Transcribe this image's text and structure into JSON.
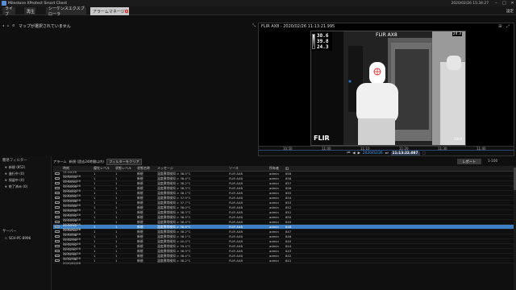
{
  "app": {
    "title": "Milestone XProtect Smart Client",
    "clock": "2020/02/26 15:34:27"
  },
  "tabs": [
    {
      "label": "ライブ"
    },
    {
      "label": "再生"
    },
    {
      "label": "シーケンスエクスプローラ"
    },
    {
      "label": "アラームマネージャ"
    }
  ],
  "setup_label": "設定",
  "map": {
    "message": "マップが選択されていません"
  },
  "video": {
    "header": "FLIR AX8 - 2020/02/26 11:13:21.995",
    "camera_label": "FLIR AX8",
    "fps": "24.3",
    "scale_values": [
      "38.6",
      "39.8",
      "24.3"
    ],
    "logo_text": "FLIR",
    "spot_value": "19.9",
    "timeline_ticks": [
      "10:50",
      "11:00",
      "11:10",
      "11:20",
      "11:30",
      "11:40"
    ],
    "date": "2020/02/26",
    "current_time": "11:13:22.087"
  },
  "left_panel": {
    "filter_heading": "簡易フィルター",
    "filters": [
      {
        "label": "新規 (852)"
      },
      {
        "label": "進行中 (0)"
      },
      {
        "label": "保留中 (0)"
      },
      {
        "label": "終了済み (0)"
      }
    ],
    "server_heading": "サーバー",
    "server": "SCH-PC-8996"
  },
  "alarm_toolbar": {
    "label": "アラーム",
    "filter_text": "新規 (過去24時間以内)",
    "clear_filter": "フィルターをクリア",
    "report": "レポート",
    "page_info": "1-100"
  },
  "table": {
    "headers": [
      "",
      "時刻",
      "優先レベル",
      "状態レベル",
      "状態名称",
      "メッセージ",
      "ソース",
      "所有者",
      "ID"
    ],
    "rows": [
      [
        "11:14:25 2020/02/26",
        "1",
        "1",
        "新規",
        "温度異常検知 > 38.5°C",
        "FLIR AX8",
        "admin",
        "858"
      ],
      [
        "11:14:20 2020/02/26",
        "1",
        "1",
        "新規",
        "温度異常検知 > 38.4°C",
        "FLIR AX8",
        "admin",
        "858"
      ],
      [
        "11:14:14 2020/02/26",
        "1",
        "1",
        "新規",
        "温度異常検知 > 38.2°C",
        "FLIR AX8",
        "admin",
        "857"
      ],
      [
        "11:14:09 2020/02/26",
        "1",
        "1",
        "新規",
        "温度異常検知 > 38.3°C",
        "FLIR AX8",
        "admin",
        "856"
      ],
      [
        "11:14:02 2020/02/26",
        "1",
        "1",
        "新規",
        "温度異常検知 > 38.1°C",
        "FLIR AX8",
        "admin",
        "855"
      ],
      [
        "11:13:51 2020/02/26",
        "1",
        "1",
        "新規",
        "温度異常検知 > 37.9°C",
        "FLIR AX8",
        "admin",
        "854"
      ],
      [
        "11:13:46 2020/02/26",
        "1",
        "1",
        "新規",
        "温度異常検知 > 37.7°C",
        "FLIR AX8",
        "admin",
        "853"
      ],
      [
        "11:13:40 2020/02/26",
        "1",
        "1",
        "新規",
        "温度異常検知 > 38.0°C",
        "FLIR AX8",
        "admin",
        "852"
      ],
      [
        "11:13:35 2020/02/26",
        "1",
        "1",
        "新規",
        "温度異常検知 > 38.3°C",
        "FLIR AX8",
        "admin",
        "851"
      ],
      [
        "11:13:31 2020/02/26",
        "1",
        "1",
        "新規",
        "温度異常検知 > 38.5°C",
        "FLIR AX8",
        "admin",
        "850"
      ],
      [
        "11:13:26 2020/02/26",
        "1",
        "1",
        "新規",
        "温度異常検知 > 38.4°C",
        "FLIR AX8",
        "admin",
        "849"
      ],
      [
        "11:13:22 2020/02/26",
        "1",
        "1",
        "新規",
        "温度異常検知 > 38.6°C",
        "FLIR AX8",
        "admin",
        "848"
      ],
      [
        "11:13:14 2020/02/26",
        "1",
        "1",
        "新規",
        "温度異常検知 > 38.2°C",
        "FLIR AX8",
        "admin",
        "847"
      ],
      [
        "11:13:06 2020/02/26",
        "1",
        "1",
        "新規",
        "温度異常検知 > 38.1°C",
        "FLIR AX8",
        "admin",
        "846"
      ],
      [
        "11:12:59 2020/02/26",
        "1",
        "1",
        "新規",
        "温度異常検知 > 40.0°C",
        "FLIR AX8",
        "admin",
        "845"
      ],
      [
        "11:12:52 2020/02/26",
        "1",
        "1",
        "新規",
        "温度異常検知 > 39.4°C",
        "FLIR AX8",
        "admin",
        "844"
      ],
      [
        "11:12:47 2020/02/26",
        "1",
        "1",
        "新規",
        "温度異常検知 > 38.9°C",
        "FLIR AX8",
        "admin",
        "843"
      ],
      [
        "11:12:41 2020/02/26",
        "1",
        "1",
        "新規",
        "温度異常検知 > 38.4°C",
        "FLIR AX8",
        "admin",
        "842"
      ],
      [
        "11:12:36 2020/02/26",
        "1",
        "1",
        "新規",
        "温度異常検知 > 38.2°C",
        "FLIR AX8",
        "admin",
        "841"
      ]
    ],
    "selected_index": 11
  }
}
